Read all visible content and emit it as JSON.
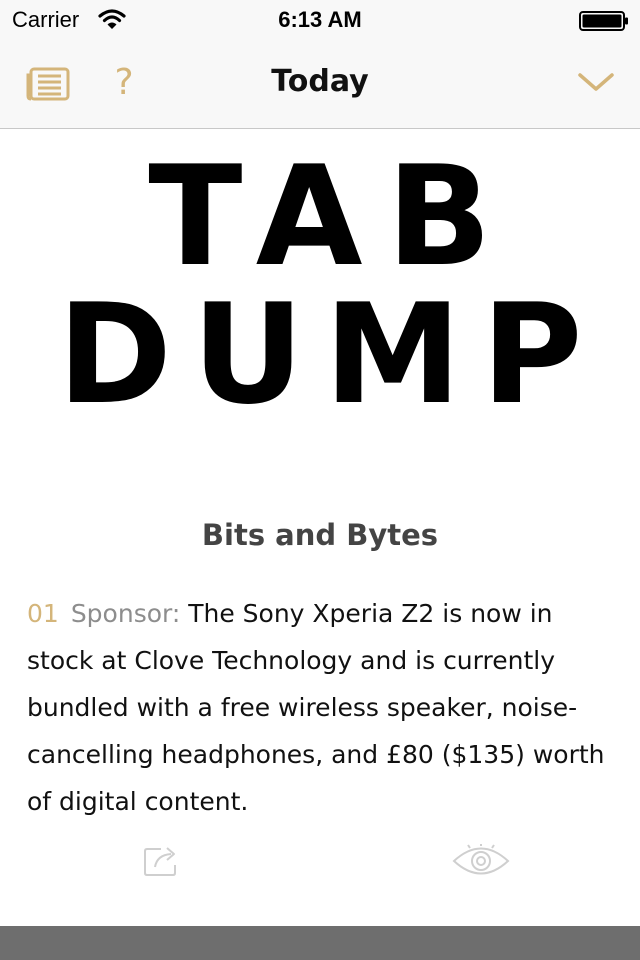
{
  "status_bar": {
    "carrier": "Carrier",
    "time": "6:13 AM"
  },
  "nav": {
    "title": "Today",
    "help_symbol": "?",
    "left_icon": "list-icon",
    "right_icon": "chevron-down-icon"
  },
  "hero": {
    "line1": "TAB",
    "line2": "DUMP"
  },
  "section": {
    "title": "Bits and Bytes"
  },
  "article": {
    "number": "01",
    "tag": "Sponsor:",
    "body": "The Sony Xperia Z2 is now in stock at Clove Technology and is currently bundled with a free wireless speaker, noise-cancelling headphones, and £80 ($135) worth of digital content."
  },
  "actions": {
    "share_icon": "share-icon",
    "view_icon": "eye-icon"
  },
  "colors": {
    "accent": "#d4b57a",
    "tag": "#8d8d8d",
    "bar_background": "#f8f8f8",
    "bottom_bar": "#6e6e6e"
  }
}
